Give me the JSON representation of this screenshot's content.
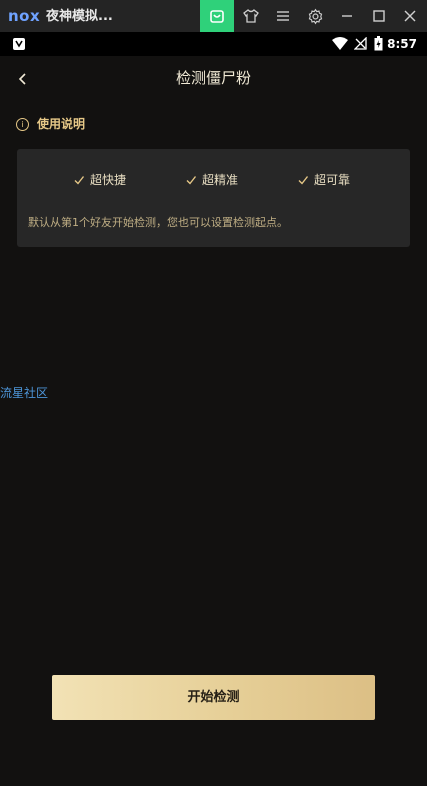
{
  "emulator": {
    "logo": "nox",
    "title": "夜神模拟...",
    "icons": [
      "store-icon",
      "shirt-icon",
      "menu-icon",
      "gear-icon",
      "minimize-icon",
      "maximize-icon",
      "close-icon"
    ],
    "accent": "#2fd17a"
  },
  "status_bar": {
    "time": "8:57",
    "icons": [
      "notification-icon",
      "wifi-icon",
      "no-signal-icon",
      "battery-icon"
    ]
  },
  "header": {
    "title": "检测僵尸粉",
    "back_icon": "chevron-left-icon"
  },
  "usage": {
    "title": "使用说明",
    "features": [
      {
        "label": "超快捷"
      },
      {
        "label": "超精准"
      },
      {
        "label": "超可靠"
      }
    ],
    "description": "默认从第1个好友开始检测，您也可以设置检测起点。"
  },
  "watermark": {
    "text": "流星社区"
  },
  "start_button": {
    "label": "开始检测"
  },
  "colors": {
    "background": "#121110",
    "gold": "#e6c887",
    "card": "#272727",
    "link": "#4d95d8"
  }
}
